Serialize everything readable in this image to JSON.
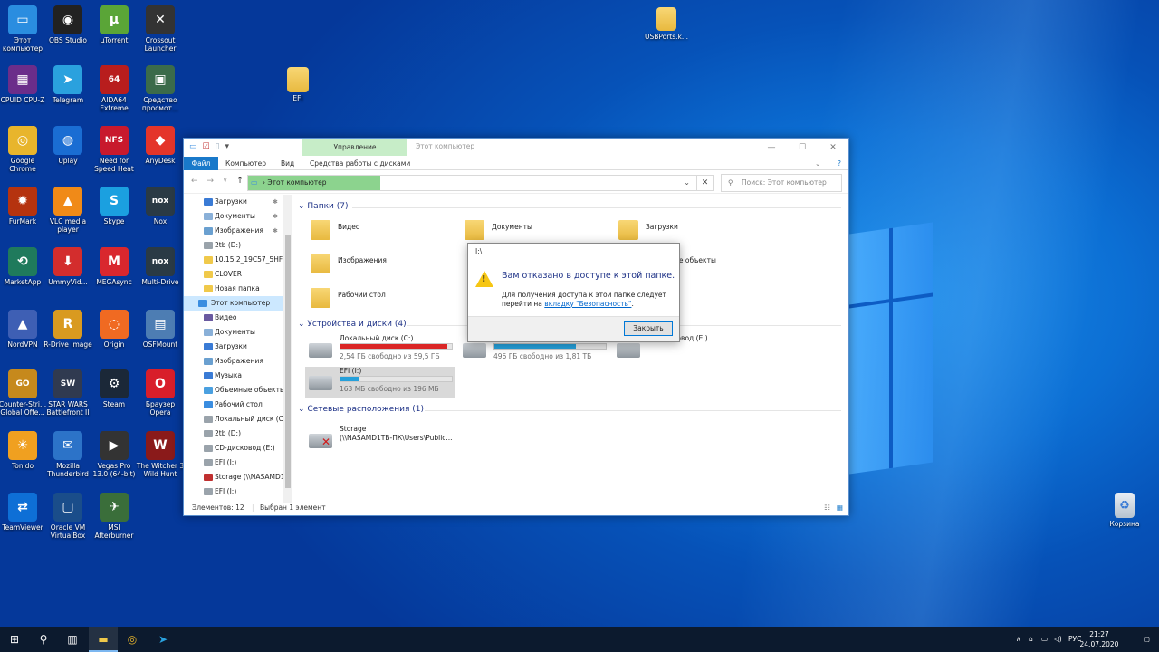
{
  "desktop": {
    "icons": [
      {
        "label": "Этот компьютер",
        "color": "#2a8de0",
        "glyph": "▭",
        "icon": "computer-icon"
      },
      {
        "label": "OBS Studio",
        "color": "#222222",
        "glyph": "◉",
        "icon": "obs-icon"
      },
      {
        "label": "µTorrent",
        "color": "#5aa537",
        "glyph": "µ",
        "icon": "utorrent-icon"
      },
      {
        "label": "Crossout Launcher",
        "color": "#333333",
        "glyph": "✕",
        "icon": "crossout-icon"
      },
      {
        "label": "CPUID CPU-Z",
        "color": "#6b2d8a",
        "glyph": "▦",
        "icon": "cpuz-icon"
      },
      {
        "label": "Telegram",
        "color": "#2aa1de",
        "glyph": "➤",
        "icon": "telegram-icon"
      },
      {
        "label": "AIDA64 Extreme",
        "color": "#b81d1d",
        "glyph": "64",
        "icon": "aida64-icon"
      },
      {
        "label": "Средство просмот...",
        "color": "#3b6b4a",
        "glyph": "▣",
        "icon": "viewer-icon"
      },
      {
        "label": "Google Chrome",
        "color": "#e8b52c",
        "glyph": "◎",
        "icon": "chrome-icon"
      },
      {
        "label": "Uplay",
        "color": "#1a6dd3",
        "glyph": "◍",
        "icon": "uplay-icon"
      },
      {
        "label": "Need for Speed Heat",
        "color": "#c8192d",
        "glyph": "NFS",
        "icon": "nfs-icon"
      },
      {
        "label": "AnyDesk",
        "color": "#e4352a",
        "glyph": "◆",
        "icon": "anydesk-icon"
      },
      {
        "label": "FurMark",
        "color": "#b5330f",
        "glyph": "✹",
        "icon": "furmark-icon"
      },
      {
        "label": "VLC media player",
        "color": "#f08a18",
        "glyph": "▲",
        "icon": "vlc-icon"
      },
      {
        "label": "Skype",
        "color": "#1ba0e0",
        "glyph": "S",
        "icon": "skype-icon"
      },
      {
        "label": "Nox",
        "color": "#2a3a45",
        "glyph": "nox",
        "icon": "nox-icon"
      },
      {
        "label": "MarketApp",
        "color": "#1f7a5c",
        "glyph": "⟲",
        "icon": "marketapp-icon"
      },
      {
        "label": "UmmyVid...",
        "color": "#d32d2d",
        "glyph": "⬇",
        "icon": "ummy-icon"
      },
      {
        "label": "MEGAsync",
        "color": "#d9272e",
        "glyph": "M",
        "icon": "mega-icon"
      },
      {
        "label": "Multi-Drive",
        "color": "#2a3a45",
        "glyph": "nox",
        "icon": "multidrive-icon"
      },
      {
        "label": "NordVPN",
        "color": "#3e5fb4",
        "glyph": "▲",
        "icon": "nordvpn-icon"
      },
      {
        "label": "R-Drive Image",
        "color": "#d99a20",
        "glyph": "R",
        "icon": "rdrive-icon"
      },
      {
        "label": "Origin",
        "color": "#f06a22",
        "glyph": "◌",
        "icon": "origin-icon"
      },
      {
        "label": "OSFMount",
        "color": "#4d7db3",
        "glyph": "▤",
        "icon": "osfmount-icon"
      },
      {
        "label": "Counter-Stri... Global Offe...",
        "color": "#c6891c",
        "glyph": "GO",
        "icon": "csgo-icon"
      },
      {
        "label": "STAR WARS Battlefront II",
        "color": "#303a50",
        "glyph": "SW",
        "icon": "starwars-icon"
      },
      {
        "label": "Steam",
        "color": "#1b2838",
        "glyph": "⚙",
        "icon": "steam-icon"
      },
      {
        "label": "Браузер Opera",
        "color": "#d81e2a",
        "glyph": "O",
        "icon": "opera-icon"
      },
      {
        "label": "Tonido",
        "color": "#f0a020",
        "glyph": "☀",
        "icon": "tonido-icon"
      },
      {
        "label": "Mozilla Thunderbird",
        "color": "#2c73c8",
        "glyph": "✉",
        "icon": "thunderbird-icon"
      },
      {
        "label": "Vegas Pro 13.0 (64-bit)",
        "color": "#333333",
        "glyph": "▶",
        "icon": "vegas-icon"
      },
      {
        "label": "The Witcher 3 Wild Hunt",
        "color": "#8a1a1a",
        "glyph": "W",
        "icon": "witcher-icon"
      },
      {
        "label": "TeamViewer",
        "color": "#0e6fd6",
        "glyph": "⇄",
        "icon": "teamviewer-icon"
      },
      {
        "label": "Oracle VM VirtualBox",
        "color": "#1a4d8a",
        "glyph": "▢",
        "icon": "virtualbox-icon"
      },
      {
        "label": "MSI Afterburner",
        "color": "#3a6e3a",
        "glyph": "✈",
        "icon": "afterburner-icon"
      }
    ],
    "efi_folder": "EFI",
    "usbports_file": "USBPorts.k...",
    "recycle_bin": "Корзина"
  },
  "explorer": {
    "title": "Этот компьютер",
    "manage_tab": "Управление",
    "ribbon": {
      "file": "Файл",
      "computer": "Компьютер",
      "view": "Вид",
      "disk_tools": "Средства работы с дисками"
    },
    "address": "Этот компьютер",
    "search_placeholder": "Поиск: Этот компьютер",
    "sidebar": [
      {
        "label": "Загрузки",
        "color": "#3a7bd5",
        "pin": true
      },
      {
        "label": "Документы",
        "color": "#8ab0d8",
        "pin": true
      },
      {
        "label": "Изображения",
        "color": "#6aa0d0",
        "pin": true
      },
      {
        "label": "2tb (D:)",
        "color": "#9aa3ab",
        "pin": false
      },
      {
        "label": "10.15.2_19C57_5HFS_",
        "color": "#f0c94a",
        "pin": false
      },
      {
        "label": "CLOVER",
        "color": "#f0c94a",
        "pin": false
      },
      {
        "label": "Новая папка",
        "color": "#f0c94a",
        "pin": false
      },
      {
        "label": "Этот компьютер",
        "color": "#3a8de0",
        "pin": false,
        "selected": true
      },
      {
        "label": "Видео",
        "color": "#6a5aa0",
        "pin": false
      },
      {
        "label": "Документы",
        "color": "#8ab0d8",
        "pin": false
      },
      {
        "label": "Загрузки",
        "color": "#3a7bd5",
        "pin": false
      },
      {
        "label": "Изображения",
        "color": "#6aa0d0",
        "pin": false
      },
      {
        "label": "Музыка",
        "color": "#3a7bd5",
        "pin": false
      },
      {
        "label": "Объемные объекты",
        "color": "#4aa0e0",
        "pin": false
      },
      {
        "label": "Рабочий стол",
        "color": "#3a8de0",
        "pin": false
      },
      {
        "label": "Локальный диск (C:)",
        "color": "#9aa3ab",
        "pin": false
      },
      {
        "label": "2tb (D:)",
        "color": "#9aa3ab",
        "pin": false
      },
      {
        "label": "CD-дисковод (E:)",
        "color": "#9aa3ab",
        "pin": false
      },
      {
        "label": "EFI (I:)",
        "color": "#9aa3ab",
        "pin": false
      },
      {
        "label": "Storage (\\\\NASAMD1",
        "color": "#c03030",
        "pin": false
      },
      {
        "label": "EFI (I:)",
        "color": "#9aa3ab",
        "pin": false
      }
    ],
    "folders_header": "Папки (7)",
    "folders": [
      "Видео",
      "Документы",
      "Загрузки",
      "Изображения",
      "Объемные объекты",
      "Рабочий стол"
    ],
    "devices_header": "Устройства и диски (4)",
    "drives": [
      {
        "name": "Локальный диск (C:)",
        "free": "2,54 ГБ свободно из 59,5 ГБ",
        "used": 0.96,
        "color": "#da2626"
      },
      {
        "name": "2tb (D:)",
        "free": "496 ГБ свободно из 1,81 ТБ",
        "used": 0.73,
        "color": "#26a0da"
      },
      {
        "name": "CD-дисковод (E:)",
        "free": "",
        "used": 0,
        "color": "#26a0da"
      },
      {
        "name": "EFI (I:)",
        "free": "163 МБ свободно из 196 МБ",
        "used": 0.17,
        "color": "#26a0da"
      }
    ],
    "network_header": "Сетевые расположения (1)",
    "network": {
      "name": "Storage",
      "path": "(\\\\NASAMD1TB-ПК\\Users\\Public..."
    },
    "status": {
      "count": "Элементов: 12",
      "selected": "Выбран 1 элемент"
    }
  },
  "dialog": {
    "title": "I:\\",
    "heading": "Вам отказано в доступе к этой папке.",
    "body_prefix": "Для получения доступа к этой папке следует перейти на ",
    "body_link": "вкладку \"Безопасность\"",
    "body_suffix": ".",
    "close_button": "Закрыть"
  },
  "taskbar": {
    "lang": "РУС",
    "time": "21:27",
    "date": "24.07.2020"
  }
}
